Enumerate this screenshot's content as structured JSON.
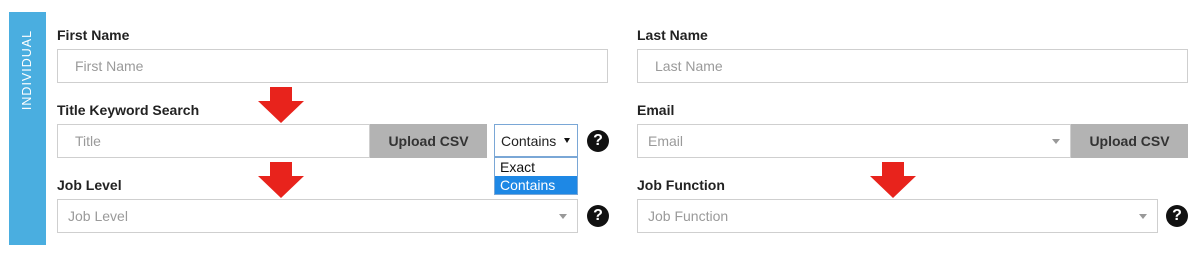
{
  "section": {
    "side_label": "INDIVIDUAL",
    "band_color": "#4aaee0"
  },
  "first_name": {
    "label": "First Name",
    "placeholder": "First Name"
  },
  "last_name": {
    "label": "Last Name",
    "placeholder": "Last Name"
  },
  "title_search": {
    "label": "Title Keyword Search",
    "placeholder": "Title",
    "upload_label": "Upload CSV",
    "match_mode": {
      "selected": "Contains",
      "options": [
        "Exact",
        "Contains"
      ],
      "highlighted": "Contains"
    }
  },
  "email": {
    "label": "Email",
    "placeholder": "Email",
    "upload_label": "Upload CSV"
  },
  "job_level": {
    "label": "Job Level",
    "placeholder": "Job Level"
  },
  "job_function": {
    "label": "Job Function",
    "placeholder": "Job Function"
  },
  "help_icon_glyph": "?",
  "colors": {
    "arrow": "#e8231c",
    "upload_button": "#b3b3b3",
    "option_highlight": "#1e88e5"
  }
}
